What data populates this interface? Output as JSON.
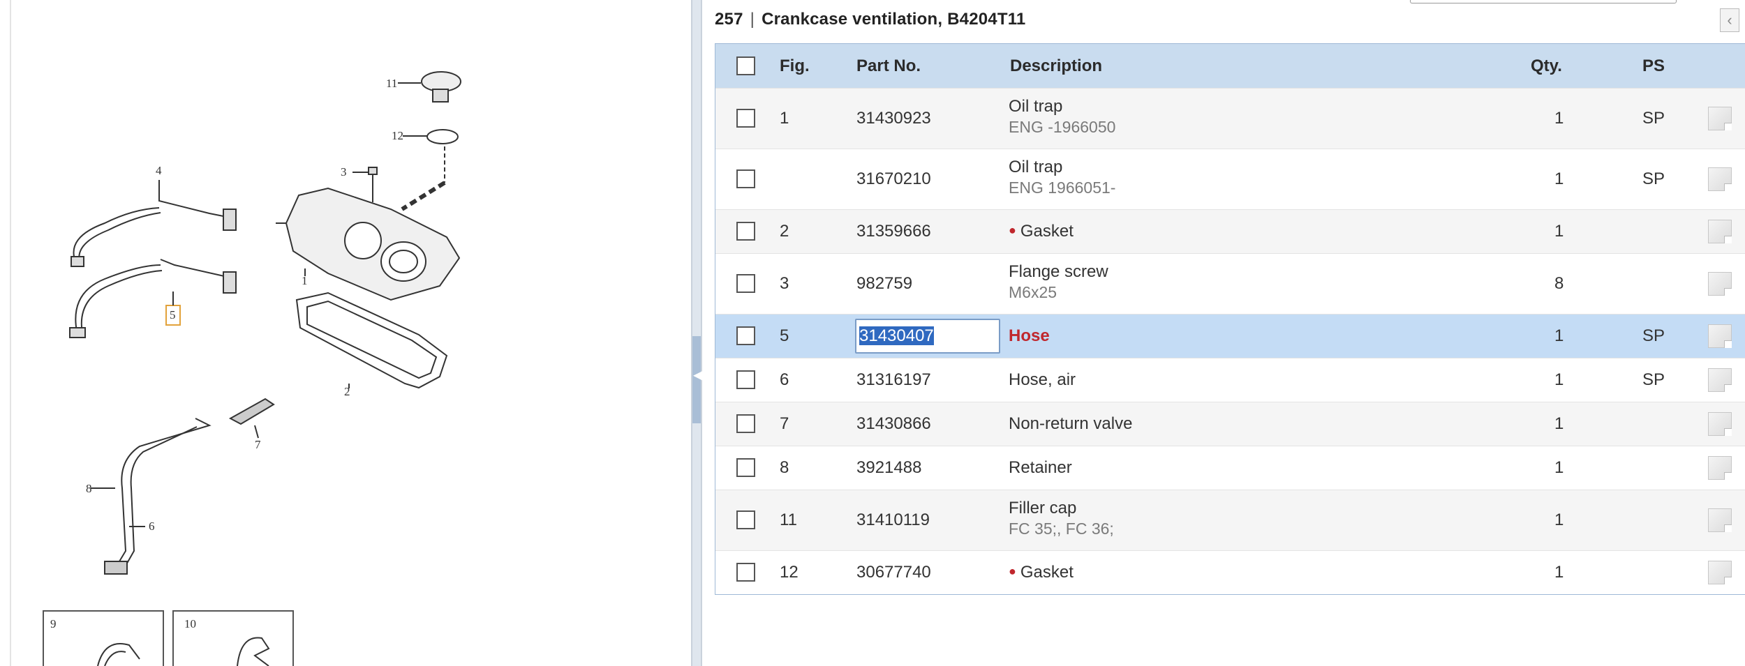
{
  "diagram": {
    "callouts": [
      "11",
      "12",
      "4",
      "3",
      "1",
      "5",
      "2",
      "7",
      "8",
      "6"
    ],
    "thumbnails": [
      "9",
      "10"
    ]
  },
  "section": {
    "number": "257",
    "separator": "|",
    "title": "Crankcase ventilation, B4204T11"
  },
  "table": {
    "headers": {
      "fig": "Fig.",
      "part_no": "Part No.",
      "description": "Description",
      "qty": "Qty.",
      "ps": "PS"
    },
    "rows": [
      {
        "fig": "1",
        "part_no": "31430923",
        "description": "Oil trap",
        "sub": "ENG -1966050",
        "qty": "1",
        "ps": "SP",
        "bullet": false,
        "selected": false
      },
      {
        "fig": "",
        "part_no": "31670210",
        "description": "Oil trap",
        "sub": "ENG 1966051-",
        "qty": "1",
        "ps": "SP",
        "bullet": false,
        "selected": false
      },
      {
        "fig": "2",
        "part_no": "31359666",
        "description": "Gasket",
        "sub": "",
        "qty": "1",
        "ps": "",
        "bullet": true,
        "selected": false
      },
      {
        "fig": "3",
        "part_no": "982759",
        "description": "Flange screw",
        "sub": "M6x25",
        "qty": "8",
        "ps": "",
        "bullet": false,
        "selected": false
      },
      {
        "fig": "5",
        "part_no": "31430407",
        "description": "Hose",
        "sub": "",
        "qty": "1",
        "ps": "SP",
        "bullet": false,
        "selected": true
      },
      {
        "fig": "6",
        "part_no": "31316197",
        "description": "Hose, air",
        "sub": "",
        "qty": "1",
        "ps": "SP",
        "bullet": false,
        "selected": false
      },
      {
        "fig": "7",
        "part_no": "31430866",
        "description": "Non-return valve",
        "sub": "",
        "qty": "1",
        "ps": "",
        "bullet": false,
        "selected": false
      },
      {
        "fig": "8",
        "part_no": "3921488",
        "description": "Retainer",
        "sub": "",
        "qty": "1",
        "ps": "",
        "bullet": false,
        "selected": false
      },
      {
        "fig": "11",
        "part_no": "31410119",
        "description": "Filler cap",
        "sub": "FC 35;, FC 36;",
        "qty": "1",
        "ps": "",
        "bullet": false,
        "selected": false
      },
      {
        "fig": "12",
        "part_no": "30677740",
        "description": "Gasket",
        "sub": "",
        "qty": "1",
        "ps": "",
        "bullet": true,
        "selected": false
      }
    ]
  },
  "colors": {
    "header_bg": "#c9dcef",
    "selected_bg": "#c4dcf5",
    "accent_red": "#c0272d"
  },
  "icons": {
    "note": "note-icon",
    "collapse": "chevron-left-icon"
  }
}
